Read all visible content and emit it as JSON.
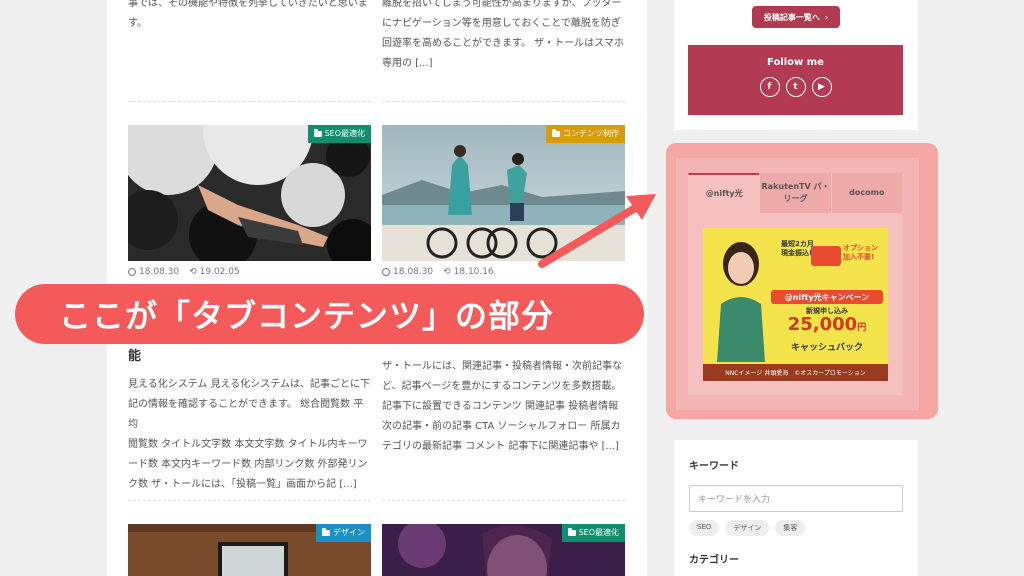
{
  "colors": {
    "accent_red": "#b03a50",
    "callout": "#f55a5a",
    "highlight": "#f7a6a6"
  },
  "posts": {
    "top_left_excerpt": [
      "事では、その機能や特徴を列挙していきたいと思いま",
      "す。"
    ],
    "top_right_excerpt": [
      "離脱を招いてしまう可能性が高まりますが、フッター",
      "にナビゲーション等を用意しておくことで離脱を防ぎ",
      "回遊率を高めることができます。 ザ・トールはスマホ",
      "専用の [...]"
    ],
    "card1": {
      "category": "SEO最適化",
      "category_color": "#0f8f6b",
      "date_posted": "18.08.30",
      "date_updated": "19.02.05",
      "title_tail": "能",
      "excerpt": [
        "見える化システム 見える化システムは、記事ごとに下",
        "記の情報を確認することができます。 総合閲覧数 平均",
        "閲覧数 タイトル文字数 本文文字数 タイトル内キーワ",
        "ード数 本文内キーワード数 内部リンク数 外部発リン",
        "ク数 ザ・トールには、「投稿一覧」画面から記 [...]"
      ]
    },
    "card2": {
      "category": "コンテンツ制作",
      "category_color": "#d99b0a",
      "date_posted": "18.08.30",
      "date_updated": "18.10.16",
      "excerpt": [
        "ザ・トールには、関連記事・投稿者情報・次前記事な",
        "ど、記事ページを豊かにするコンテンツを多数搭載。",
        "記事下に設置できるコンテンツ 関連記事 投稿者情報",
        "次の記事・前の記事 CTA ソーシャルフォロー 所属カ",
        "テゴリの最新記事 コメント 記事下に関連記事や [...]"
      ]
    },
    "card3": {
      "category": "デザイン",
      "category_color": "#1b8fc7"
    },
    "card4": {
      "category": "SEO最適化",
      "category_color": "#0f8f6b"
    }
  },
  "sidebar": {
    "posts_button": "投稿記事一覧へ",
    "follow_title": "Follow me",
    "social": [
      "f",
      "t",
      "▶"
    ],
    "tabs": [
      "@nifty光",
      "RakutenTV パ・リーグ",
      "docomo"
    ],
    "banner": {
      "line1": "最短2カ月",
      "line2": "現金振込!",
      "opt1": "オプション",
      "opt2": "加入不要!",
      "campaign": "@nifty光キャンペーン",
      "apply": "新規申し込み",
      "amount": "25,000",
      "yen": "円",
      "cashback": "キャッシュバック",
      "foot1": "NNCイメージ 井頭愛海",
      "foot2": "©オスカープロモーション"
    },
    "keyword_title": "キーワード",
    "keyword_placeholder": "キーワードを入力",
    "keyword_tags": [
      "SEO",
      "デザイン",
      "集客"
    ],
    "category_title": "カテゴリー"
  },
  "callout_text": "ここが「タブコンテンツ」の部分"
}
